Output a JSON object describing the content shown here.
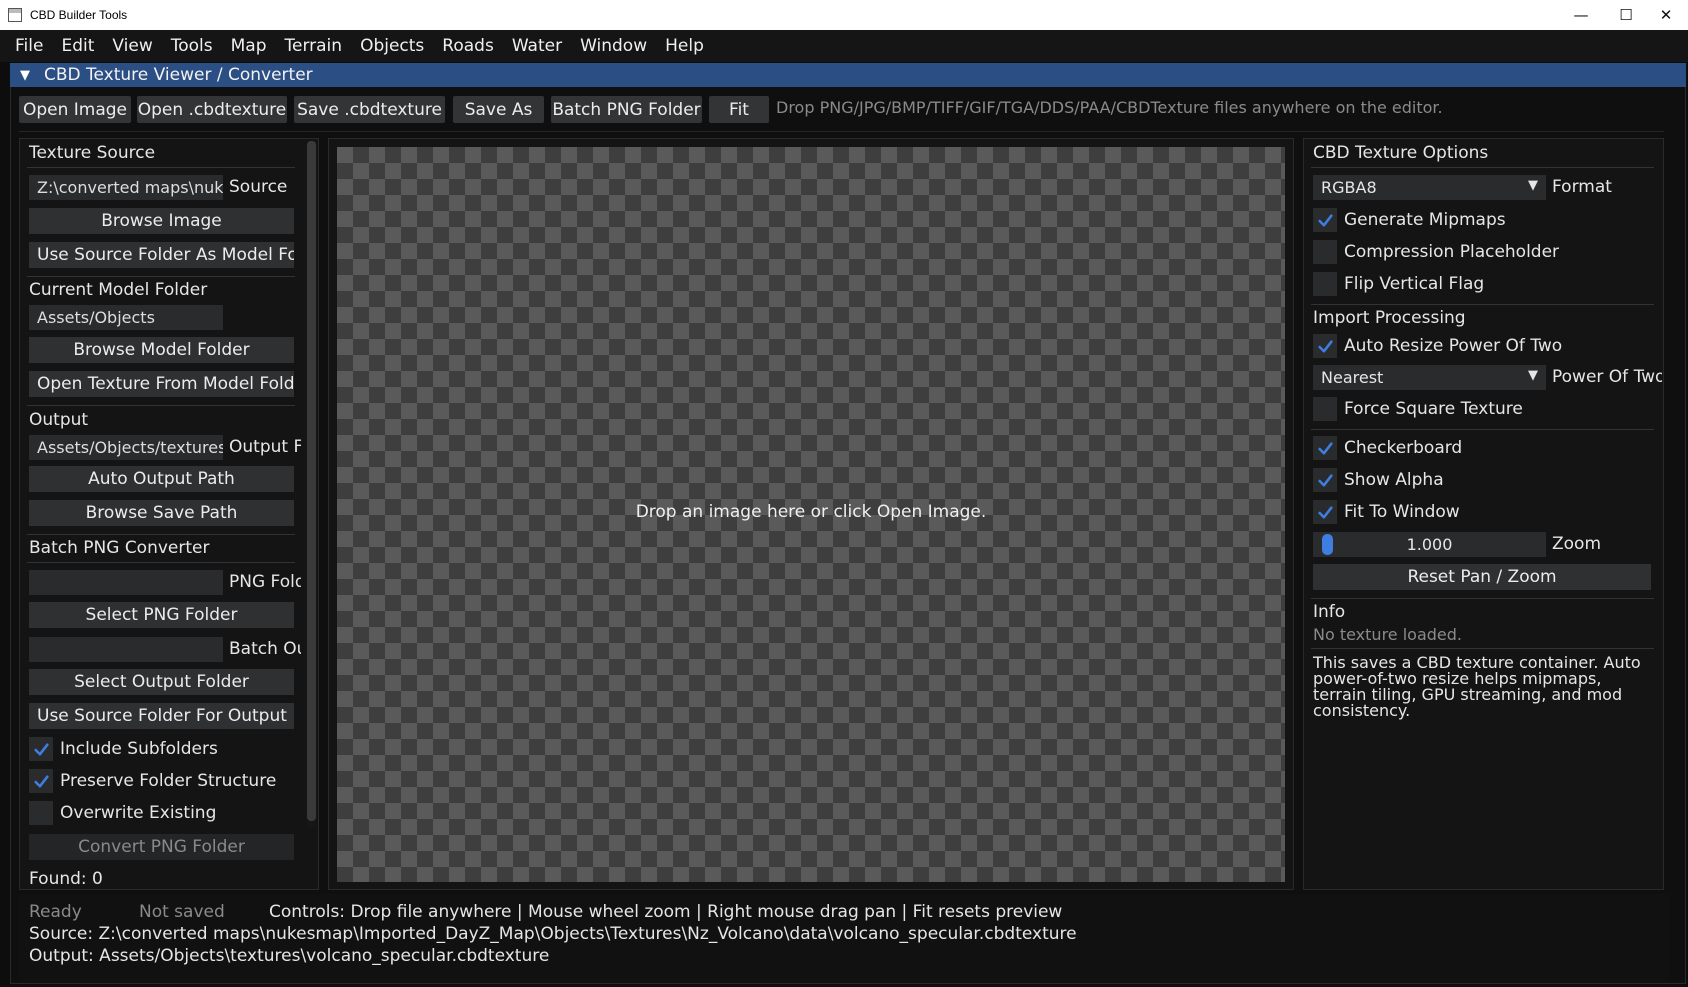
{
  "window": {
    "title": "CBD Builder Tools",
    "minimize": "—",
    "maximize": "☐",
    "close": "✕"
  },
  "menu": [
    "File",
    "Edit",
    "View",
    "Tools",
    "Map",
    "Terrain",
    "Objects",
    "Roads",
    "Water",
    "Window",
    "Help"
  ],
  "panel_title": "CBD Texture Viewer / Converter",
  "toolbar": {
    "open_image": "Open Image",
    "open_cbdtexture": "Open .cbdtexture",
    "save_cbdtexture": "Save .cbdtexture",
    "save_as": "Save As",
    "batch_png": "Batch PNG Folder",
    "fit": "Fit",
    "drop_hint": "Drop PNG/JPG/BMP/TIFF/GIF/TGA/DDS/PAA/CBDTexture files anywhere on the editor."
  },
  "left": {
    "texture_source": "Texture Source",
    "source_value": "Z:\\converted maps\\nukesmap",
    "source_label": "Source",
    "browse_image": "Browse Image",
    "use_source_folder": "Use Source Folder As Model Folder",
    "current_model_folder": "Current Model Folder",
    "model_folder_value": "Assets/Objects",
    "browse_model_folder": "Browse Model Folder",
    "open_texture_from_model": "Open Texture From Model Folder",
    "output": "Output",
    "output_value": "Assets/Objects/textures",
    "output_label": "Output File",
    "auto_output_path": "Auto Output Path",
    "browse_save_path": "Browse Save Path",
    "batch_png_converter": "Batch PNG Converter",
    "png_folder_value": "",
    "png_folder_label": "PNG Folder",
    "select_png_folder": "Select PNG Folder",
    "batch_output_value": "",
    "batch_output_label": "Batch Output",
    "select_output_folder": "Select Output Folder",
    "use_source_for_output": "Use Source Folder For Output",
    "include_subfolders": "Include Subfolders",
    "include_subfolders_checked": true,
    "preserve_structure": "Preserve Folder Structure",
    "preserve_structure_checked": true,
    "overwrite_existing": "Overwrite Existing",
    "overwrite_existing_checked": false,
    "convert_png_folder": "Convert PNG Folder",
    "found": "Found: 0"
  },
  "preview": {
    "message": "Drop an image here or click Open Image."
  },
  "right": {
    "cbd_texture_options": "CBD Texture Options",
    "format_value": "RGBA8",
    "format_label": "Format",
    "generate_mipmaps": "Generate Mipmaps",
    "generate_mipmaps_checked": true,
    "compression_placeholder": "Compression Placeholder",
    "compression_placeholder_checked": false,
    "flip_vertical": "Flip Vertical Flag",
    "flip_vertical_checked": false,
    "import_processing": "Import Processing",
    "auto_resize": "Auto Resize Power Of Two",
    "auto_resize_checked": true,
    "resize_mode_value": "Nearest",
    "resize_mode_label": "Power Of Two",
    "force_square": "Force Square Texture",
    "force_square_checked": false,
    "checkerboard": "Checkerboard",
    "checkerboard_checked": true,
    "show_alpha": "Show Alpha",
    "show_alpha_checked": true,
    "fit_to_window": "Fit To Window",
    "fit_to_window_checked": true,
    "zoom_value": "1.000",
    "zoom_label": "Zoom",
    "reset_pan_zoom": "Reset Pan / Zoom",
    "info": "Info",
    "no_texture": "No texture loaded.",
    "description": "This saves a CBD texture container. Auto power-of-two resize helps mipmaps, terrain tiling, GPU streaming, and mod consistency."
  },
  "status": {
    "ready": "Ready",
    "not_saved": "Not saved",
    "controls": "Controls: Drop file anywhere | Mouse wheel zoom | Right mouse drag pan | Fit resets preview",
    "source": "Source: Z:\\converted maps\\nukesmap\\Imported_DayZ_Map\\Objects\\Textures\\Nz_Volcano\\data\\volcano_specular.cbdtexture",
    "output": "Output: Assets/Objects\\textures\\volcano_specular.cbdtexture"
  },
  "colors": {
    "accent": "#3d7ee0",
    "title_bar": "#2b4e84",
    "background": "#0f0f0f",
    "dim_text": "#8a8a8a"
  }
}
